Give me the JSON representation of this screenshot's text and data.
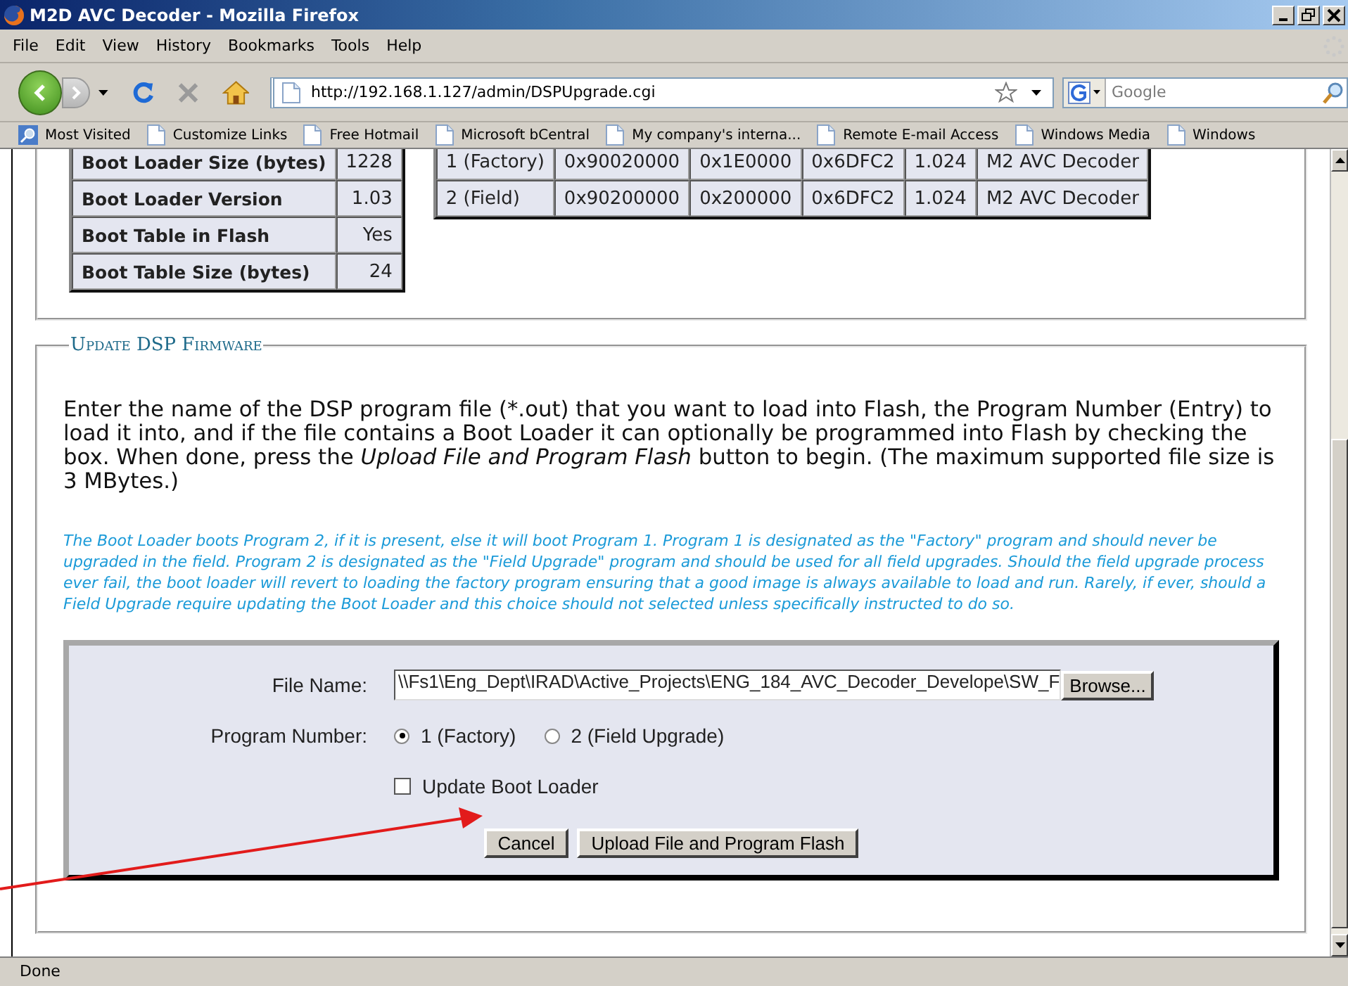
{
  "window": {
    "title": "M2D AVC Decoder - Mozilla Firefox"
  },
  "menu": [
    "File",
    "Edit",
    "View",
    "History",
    "Bookmarks",
    "Tools",
    "Help"
  ],
  "address": {
    "value": "http://192.168.1.127/admin/DSPUpgrade.cgi"
  },
  "search": {
    "placeholder": "Google"
  },
  "bookmarks": [
    {
      "label": "Most Visited",
      "kind": "smart"
    },
    {
      "label": "Customize Links",
      "kind": "page"
    },
    {
      "label": "Free Hotmail",
      "kind": "page"
    },
    {
      "label": "Microsoft bCentral",
      "kind": "page"
    },
    {
      "label": "My company's interna...",
      "kind": "page"
    },
    {
      "label": "Remote E-mail Access",
      "kind": "page"
    },
    {
      "label": "Windows Media",
      "kind": "page"
    },
    {
      "label": "Windows",
      "kind": "page"
    }
  ],
  "boot_table": {
    "rows": [
      {
        "label": "Boot Loader Size (bytes)",
        "value": "1228"
      },
      {
        "label": "Boot Loader Version",
        "value": "1.03"
      },
      {
        "label": "Boot Table in Flash",
        "value": "Yes"
      },
      {
        "label": "Boot Table Size (bytes)",
        "value": "24"
      }
    ]
  },
  "program_table": {
    "rows": [
      [
        "1 (Factory)",
        "0x90020000",
        "0x1E0000",
        "0x6DFC2",
        "1.024",
        "M2 AVC Decoder"
      ],
      [
        "2 (Field)",
        "0x90200000",
        "0x200000",
        "0x6DFC2",
        "1.024",
        "M2 AVC Decoder"
      ]
    ]
  },
  "update_section": {
    "legend": "Update DSP Firmware",
    "intro": [
      {
        "text": "Enter the name of the DSP program file (*.out) that you want to load into Flash, the Program Number (Entry) to load it into, and if the file contains a Boot Loader it can optionally be programmed into Flash by checking the box.  When done, press the ",
        "italic": false
      },
      {
        "text": "Upload File and Program Flash",
        "italic": true
      },
      {
        "text": " button to begin.  (The maximum supported file size is 3 MBytes.)",
        "italic": false
      }
    ],
    "note": "The Boot Loader boots Program 2, if it is present, else it will boot Program 1.  Program 1 is designated as the \"Factory\" program and should never be upgraded in the field.  Program 2 is designated as the \"Field Upgrade\" program and should be used for all field upgrades.  Should the field upgrade process ever fail, the boot loader will revert to loading the factory program ensuring that a good image is always available to load and run.  Rarely, if ever, should a Field Upgrade require updating the Boot Loader and this choice should not selected unless specifically instructed to do so.",
    "form": {
      "file_label": "File Name:",
      "file_value": "\\\\Fs1\\Eng_Dept\\IRAD\\Active_Projects\\ENG_184_AVC_Decoder_Develope\\SW_F",
      "browse": "Browse...",
      "program_label": "Program Number:",
      "program_options": [
        {
          "label": "1 (Factory)",
          "selected": true
        },
        {
          "label": "2 (Field Upgrade)",
          "selected": false
        }
      ],
      "boot_loader": {
        "label": "Update Boot Loader",
        "checked": false
      },
      "buttons": [
        "Cancel",
        "Upload File and Program Flash"
      ]
    }
  },
  "status_bar": "Done"
}
